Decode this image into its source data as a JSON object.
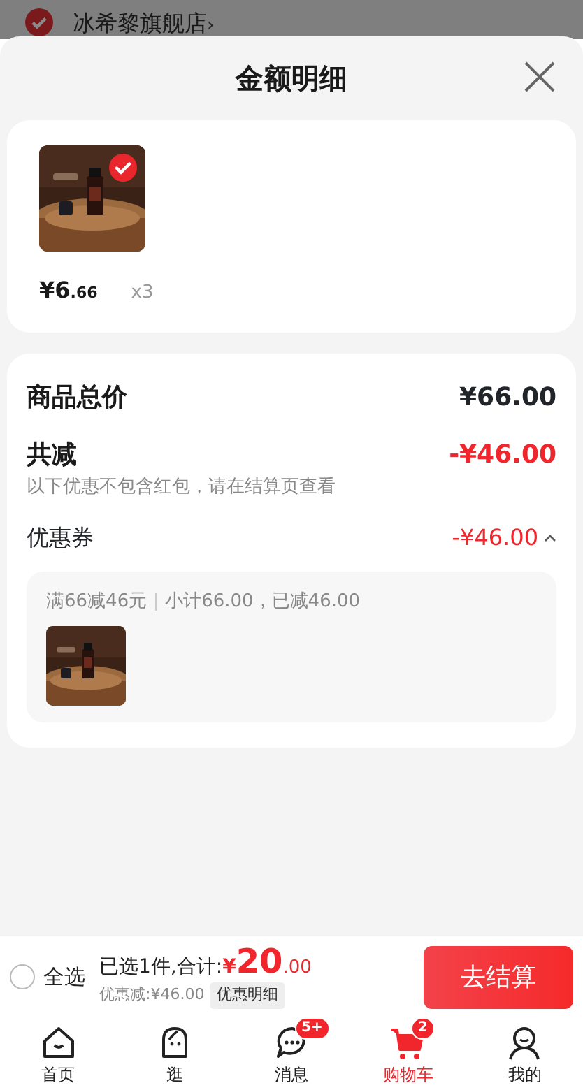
{
  "store": {
    "name": "冰希黎旗舰店",
    "chevron": "›",
    "checked": true
  },
  "sheet": {
    "title": "金额明细"
  },
  "products": [
    {
      "kind": "picture",
      "selected": true,
      "price_integer": "¥6",
      "price_decimal": ".66",
      "quantity": "x3"
    }
  ],
  "summary": {
    "total_label": "商品总价",
    "total_value": "¥66.00",
    "discount_label": "共减",
    "discount_value": "-¥46.00",
    "discount_note": "以下优惠不包含红包，请在结算页查看",
    "coupon": {
      "label": "优惠券",
      "value": "-¥46.00",
      "expanded": true,
      "rule": "满66减46元",
      "subtotal": "小计66.00，已减46.00"
    }
  },
  "checkout": {
    "select_all": {
      "label": "全选",
      "checked": false
    },
    "selected_label": "已选1件,合计:",
    "currency": "¥",
    "amount_integer": "20",
    "amount_decimal": ".00",
    "saved": "优惠减:¥46.00",
    "detail_button": "优惠明细",
    "submit": "去结算"
  },
  "tabs": [
    {
      "label": "首页",
      "kind": "home",
      "selected": false
    },
    {
      "label": "逛",
      "kind": "face",
      "selected": false
    },
    {
      "label": "消息",
      "kind": "chat",
      "selected": false,
      "badge": "5+"
    },
    {
      "label": "购物车",
      "kind": "cart",
      "selected": true,
      "badge": "2"
    },
    {
      "label": "我的",
      "kind": "user",
      "selected": false
    }
  ]
}
